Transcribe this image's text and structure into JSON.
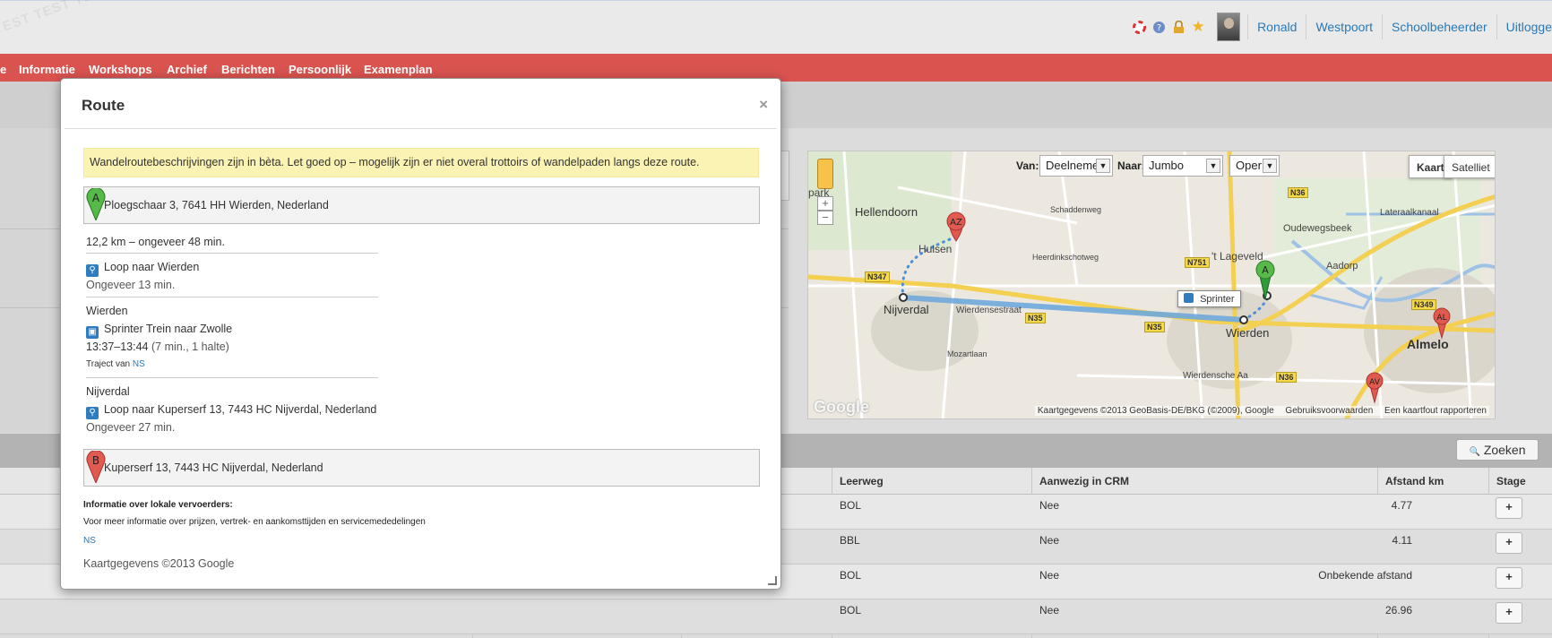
{
  "topbar": {
    "watermark": "TEST TEST TEST",
    "icons": [
      "lifebuoy-icon",
      "help-icon",
      "lock-icon",
      "star-icon"
    ],
    "user_links": [
      "Ronald",
      "Westpoort",
      "Schoolbeheerder",
      "Uitlogge"
    ]
  },
  "nav": {
    "items": [
      "e",
      "Informatie",
      "Workshops",
      "Archief",
      "Berichten",
      "Persoonlijk",
      "Examenplan"
    ]
  },
  "modal": {
    "title": "Route",
    "close": "×",
    "warning": "Wandelroutebeschrijvingen zijn in bèta. Let goed op – mogelijk zijn er niet overal trottoirs of wandelpaden langs deze route.",
    "start": {
      "marker": "A",
      "address": "Ploegschaar 3, 7641 HH Wierden, Nederland"
    },
    "summary": "12,2 km – ongeveer 48 min.",
    "steps": {
      "walk1": "Loop naar Wierden",
      "walk1_time": "Ongeveer 13 min.",
      "stop1": "Wierden",
      "train": "Sprinter Trein naar Zwolle",
      "train_time": "13:37–13:44",
      "train_detail": "(7 min., 1 halte)",
      "traject_prefix": "Traject van",
      "traject_link": "NS",
      "stop2": "Nijverdal",
      "walk2": "Loop naar Kuperserf 13, 7443 HC Nijverdal, Nederland",
      "walk2_time": "Ongeveer 27 min."
    },
    "end": {
      "marker": "B",
      "address": "Kuperserf 13, 7443 HC Nijverdal, Nederland"
    },
    "info_heading": "Informatie over lokale vervoerders:",
    "info_text": "Voor meer informatie over prijzen, vertrek- en aankomsttijden en servicemededelingen",
    "info_link": "NS",
    "copyright": "Kaartgegevens ©2013 Google"
  },
  "map": {
    "van_label": "Van:",
    "van_value": "Deelneme",
    "naar_label": "Naar:",
    "naar_value": "Jumbo",
    "mode_value": "Oper",
    "type_kaart": "Kaart",
    "type_satelliet": "Satelliet",
    "zoom_in": "+",
    "zoom_out": "−",
    "logo": "Google",
    "sprinter_label": "Sprinter",
    "copyright": "Kaartgegevens ©2013 GeoBasis-DE/BKG (©2009), Google",
    "terms": "Gebruiksvoorwaarden",
    "report": "Een kaartfout rapporteren",
    "places": {
      "hellendoorn": "Hellendoorn",
      "hulsen": "Hulsen",
      "nijverdal": "Nijverdal",
      "wierden": "Wierden",
      "almelo": "Almelo",
      "aadorp": "Aadorp",
      "lageveld": "'t Lageveld",
      "park": "park",
      "oudewegsbeek": "Oudewegsbeek",
      "lateraalkanaal": "Lateraalkanaal",
      "wierdensestraat": "Wierdensestraat",
      "wierdensche_aa": "Wierdensche Aa",
      "heerdinkschotweg": "Heerdinkschotweg",
      "mozartlaan": "Mozartlaan",
      "schaddenweg": "Schaddenweg"
    },
    "roads": [
      "N347",
      "N35",
      "N35",
      "N751",
      "N36",
      "N349",
      "N36"
    ],
    "markers": [
      "AZ",
      "A",
      "AL",
      "AV"
    ]
  },
  "search": {
    "button": "Zoeken"
  },
  "table": {
    "headers": {
      "leerweg": "Leerweg",
      "crm": "Aanwezig in CRM",
      "afstand": "Afstand km",
      "stage": "Stage"
    },
    "rows": [
      {
        "leerweg": "BOL",
        "crm": "Nee",
        "afstand": "4.77",
        "stage": "+"
      },
      {
        "leerweg": "BBL",
        "crm": "Nee",
        "afstand": "4.11",
        "stage": "+"
      },
      {
        "leerweg": "BOL",
        "crm": "Nee",
        "afstand": "Onbekende afstand",
        "stage": "+"
      },
      {
        "leerweg": "BOL",
        "crm": "Nee",
        "afstand": "26.96",
        "stage": "+"
      }
    ]
  },
  "colors": {
    "nav_red": "#d9534f",
    "link_blue": "#2a78b5",
    "warning_yellow": "#fbf3b3",
    "route_blue": "#5b9bd5"
  }
}
